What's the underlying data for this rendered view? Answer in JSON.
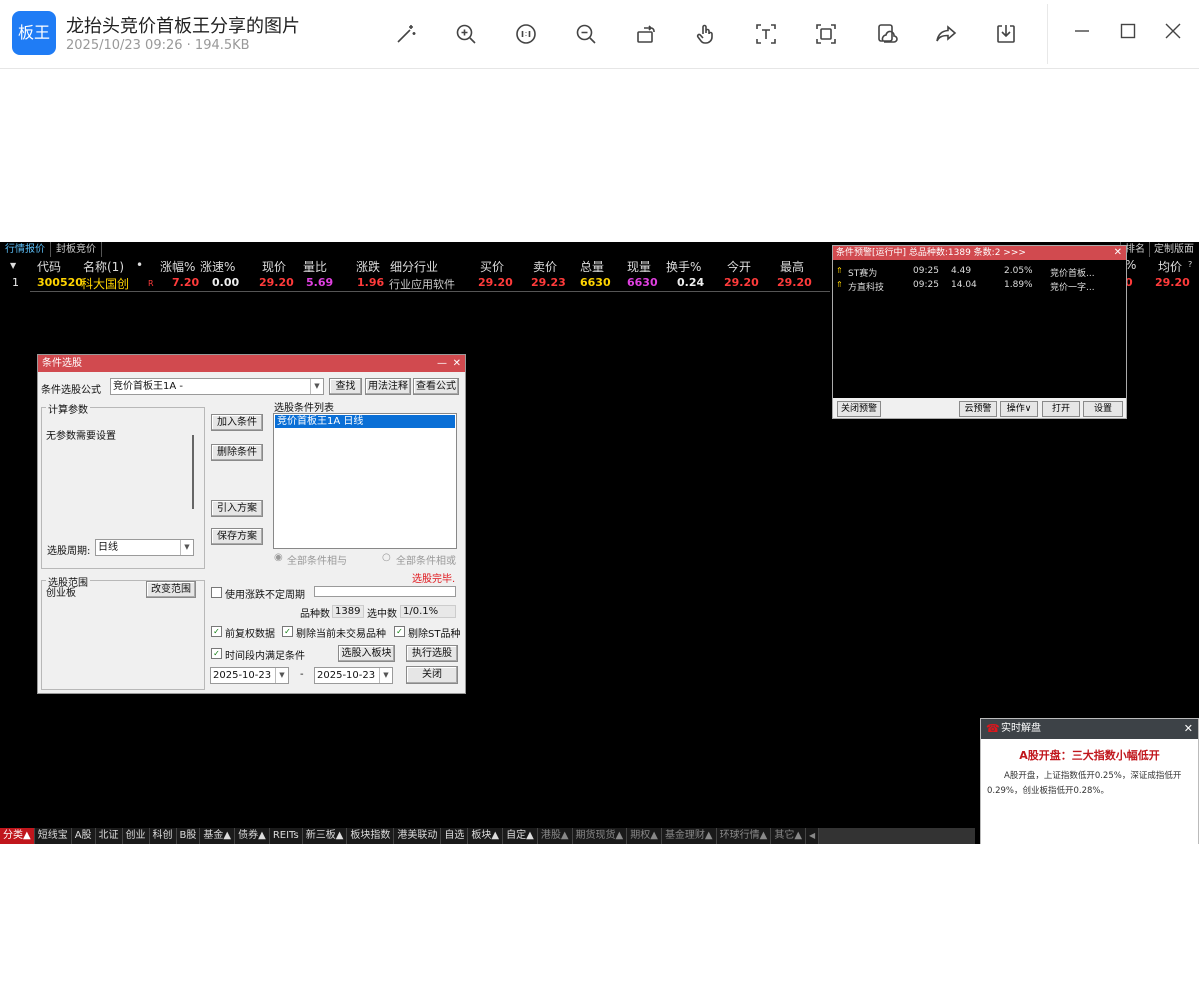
{
  "viewer": {
    "app_icon_text": "板王",
    "title": "龙抬头竞价首板王分享的图片",
    "meta": "2025/10/23 09:26 · 194.5KB",
    "toolbar_icons": [
      "magic-wand-icon",
      "zoom-in-icon",
      "original-size-icon",
      "zoom-out-icon",
      "rotate-icon",
      "hand-icon",
      "text-extract-icon",
      "scan-icon",
      "cloud-icon",
      "share-icon",
      "download-icon"
    ],
    "window_icons": [
      "minimize-icon",
      "maximize-icon",
      "close-icon"
    ]
  },
  "quote": {
    "tabs": [
      "行情报价",
      "封板竞价"
    ],
    "right_tabs": [
      "排名",
      "定制版面"
    ],
    "headers": {
      "marker": "▼",
      "code": "代码",
      "name": "名称(1)",
      "dot": "•",
      "zf": "涨幅%",
      "zs": "涨速%",
      "xj": "现价",
      "lb": "量比",
      "zd": "涨跌",
      "hy": "细分行业",
      "mr": "买价",
      "mc": "卖价",
      "zl": "总量",
      "xl": "现量",
      "hs": "换手%",
      "jk": "今开",
      "zg": "最高",
      "pct": "%",
      "jj": "均价",
      "q": "?"
    },
    "row": {
      "idx": "1",
      "code": "300520",
      "name": "科大国创",
      "flag": "R",
      "zf": "7.20",
      "zs": "0.00",
      "xj": "29.20",
      "lb": "5.69",
      "zd": "1.96",
      "hy": "行业应用软件",
      "mr": "29.20",
      "mc": "29.23",
      "zl": "6630",
      "xl": "6630",
      "hs": "0.24",
      "jk": "29.20",
      "zg": "29.20",
      "pct_val": "0",
      "jj": "29.20"
    }
  },
  "dialog": {
    "title": "条件选股",
    "formula_label": "条件选股公式",
    "formula_value": "竞价首板王1A  -",
    "find_btn": "查找",
    "usage_btn": "用法注释",
    "view_btn": "查看公式",
    "params_group": "计算参数",
    "params_text": "无参数需要设置",
    "add_btn": "加入条件",
    "del_btn": "删除条件",
    "import_btn": "引入方案",
    "save_btn": "保存方案",
    "cond_list_label": "选股条件列表",
    "cond_items": [
      "竞价首板王1A  日线"
    ],
    "and_label": "全部条件相与",
    "or_label": "全部条件相或",
    "period_label": "选股周期:",
    "period_value": "日线",
    "done_text": "选股完毕.",
    "range_group": "选股范围",
    "range_value": "创业板",
    "change_range_btn": "改变范围",
    "uncertain_period": "使用涨跌不定周期",
    "count_label": "品种数",
    "count_value": "1389",
    "hit_label": "选中数",
    "hit_value": "1/0.1%",
    "adj_label": "前复权数据",
    "del_untraded": "剔除当前未交易品种",
    "del_st": "剔除ST品种",
    "time_label": "时间段内满足条件",
    "to_block_btn": "选股入板块",
    "exec_btn": "执行选股",
    "date_from": "2025-10-23",
    "date_sep": "-",
    "date_to": "2025-10-23",
    "close_btn": "关闭"
  },
  "warning": {
    "title": "条件预警[运行中] 总品种数:1389 条数:2  >>>",
    "rows": [
      {
        "name": "ST赛为",
        "time": "09:25",
        "price": "4.49",
        "pct": "2.05%",
        "formula": "竞价首板..."
      },
      {
        "name": "方直科技",
        "time": "09:25",
        "price": "14.04",
        "pct": "1.89%",
        "formula": "竞价一字..."
      }
    ],
    "close_warn": "关闭预警",
    "cloud_warn": "云预警",
    "ops": "操作∨",
    "open": "打开",
    "settings": "设置"
  },
  "live": {
    "title": "实时解盘",
    "headline": "A股开盘：三大指数小幅低开",
    "body": "A股开盘，上证指数低开0.25%，深证成指低开0.29%，创业板指低开0.28%。"
  },
  "bottom_tabs": [
    "分类▲",
    "短线宝",
    "A股",
    "北证",
    "创业",
    "科创",
    "B股",
    "基金▲",
    "债券▲",
    "REITs",
    "新三板▲",
    "板块指数",
    "港美联动",
    "自选",
    "板块▲",
    "自定▲",
    "港股▲",
    "期货现货▲",
    "期权▲",
    "基金理财▲",
    "环球行情▲",
    "其它▲"
  ],
  "colors": {
    "accent_blue": "#1f7cf5",
    "title_red": "#d14a4f",
    "price_red": "#ff3b3b",
    "code_yellow": "#ffd400",
    "select_blue": "#0a6fd6"
  }
}
